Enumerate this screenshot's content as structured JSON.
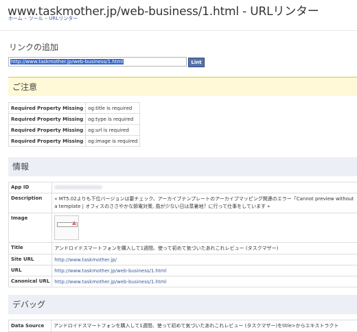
{
  "page": {
    "title": "www.taskmother.jp/web-business/1.html - URLリンター",
    "breadcrumb": [
      "ホーム",
      "ツール",
      "URLリンター"
    ]
  },
  "lint_form": {
    "heading": "リンクの追加",
    "url_value": "http://www.taskmother.jp/web-business/1.html",
    "button_label": "Lint"
  },
  "warnings": {
    "heading": "ご注意",
    "rows": [
      {
        "key": "Required Property Missing",
        "value": "og:title is required"
      },
      {
        "key": "Required Property Missing",
        "value": "og:type is required"
      },
      {
        "key": "Required Property Missing",
        "value": "og:url is required"
      },
      {
        "key": "Required Property Missing",
        "value": "og:image is required"
      }
    ]
  },
  "info": {
    "heading": "情報",
    "app_id_label": "App ID",
    "description_label": "Description",
    "description_value": "« MT5.02よりも下位バージョンは要チェック、アーカイブテンプレートのアーカイブマッピング関連のエラー「Cannot preview without a template | オフィスのささやかな節電対策, 風が少ない日は蒸暑地？に行って仕事をしています »",
    "image_label": "Image",
    "image_thumb_text": "Powered by",
    "title_label": "Title",
    "title_value": "アンドロイドスマートフォンを購入して1週間、使って初めて気づいたあれこれレビュー (タスクマザー)",
    "site_url_label": "Site URL",
    "site_url_value": "http://www.taskmother.jp/",
    "url_label": "URL",
    "url_value": "http://www.taskmother.jp/web-business/1.html",
    "canonical_label": "Canonical URL",
    "canonical_value": "http://www.taskmother.jp/web-business/1.html"
  },
  "debug": {
    "heading": "デバッグ",
    "data_source_label": "Data Source",
    "data_source_value": "アンドロイドスマートフォンを購入して1週間、使って初めて気づいたあれこれレビュー (タスクマザー)をtitle>からエキストラクト"
  }
}
